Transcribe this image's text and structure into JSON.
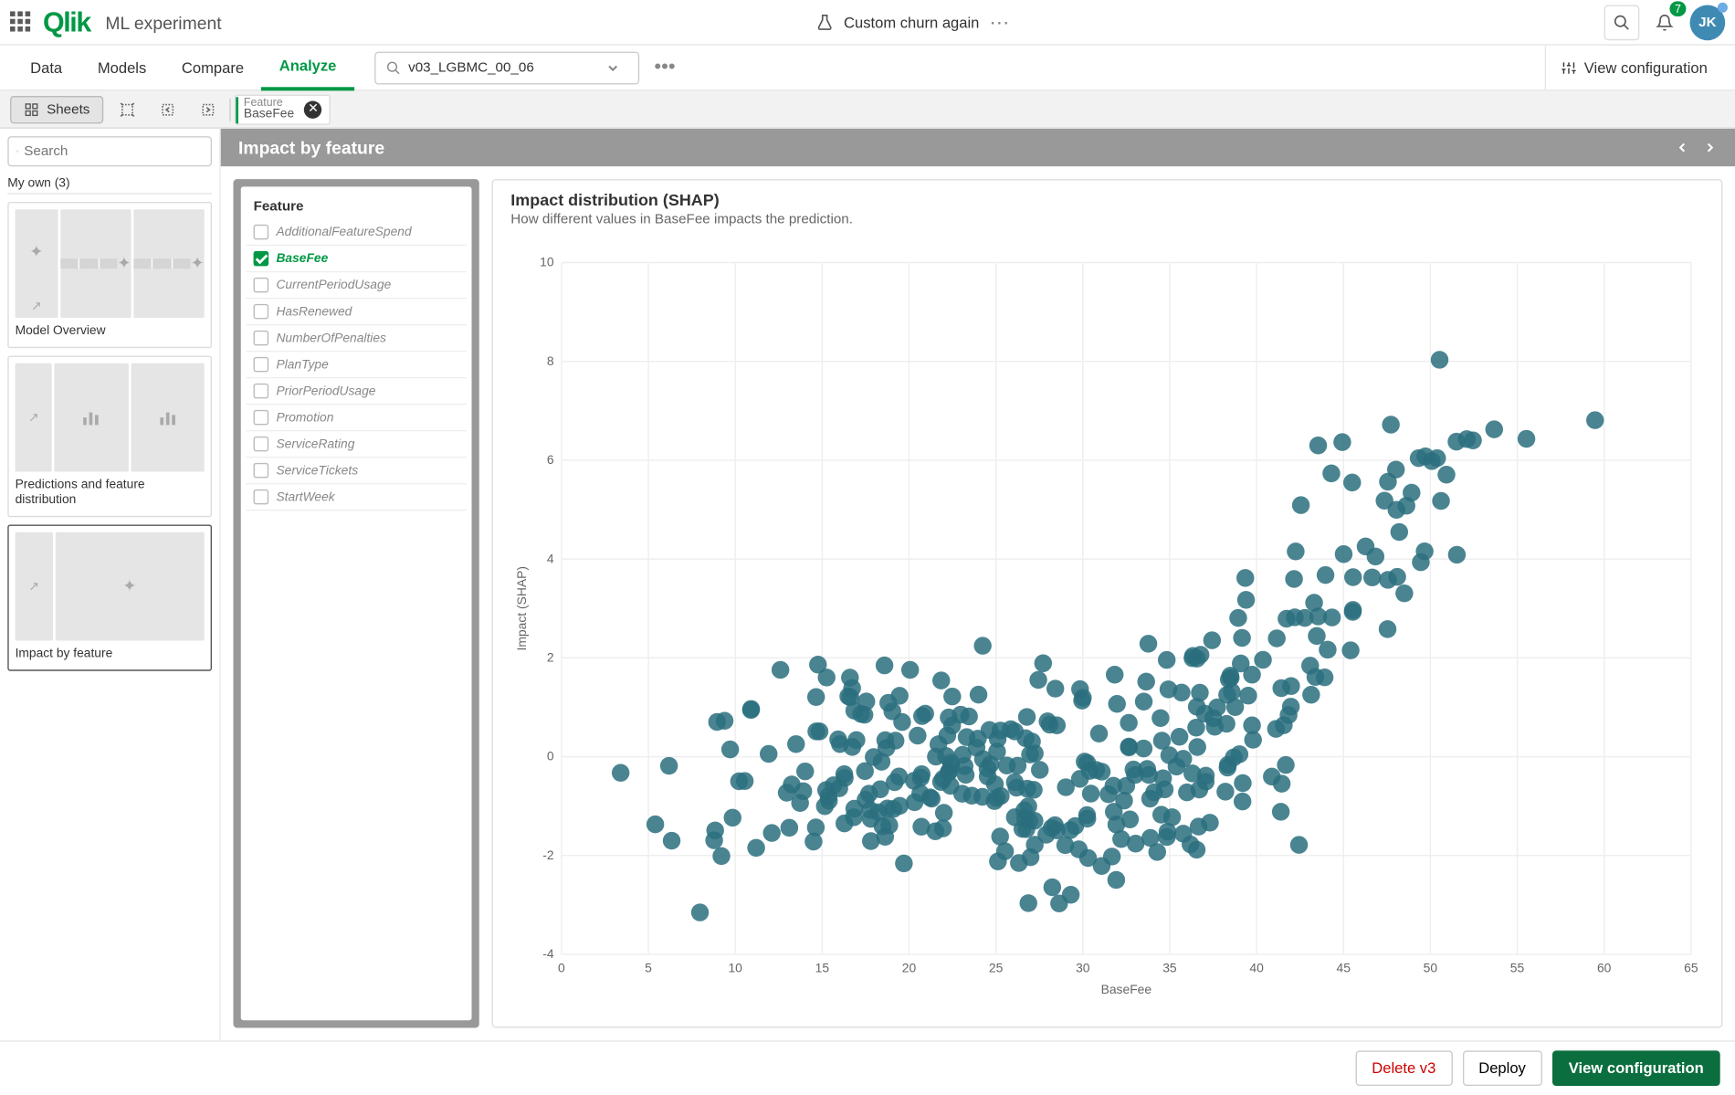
{
  "header": {
    "app_title": "ML experiment",
    "experiment_name": "Custom churn again",
    "search_aria": "Search",
    "notification_count": "7",
    "avatar_initials": "JK"
  },
  "subbar": {
    "tabs": [
      "Data",
      "Models",
      "Compare",
      "Analyze"
    ],
    "active_tab": 3,
    "model_selected": "v03_LGBMC_00_06",
    "view_config": "View configuration"
  },
  "thirdbar": {
    "sheets_label": "Sheets",
    "feature_tag_label": "Feature",
    "feature_tag_value": "BaseFee"
  },
  "sidebar": {
    "search_placeholder": "Search",
    "myown_label": "My own (3)",
    "sheets": [
      {
        "label": "Model Overview"
      },
      {
        "label": "Predictions and feature distribution"
      },
      {
        "label": "Impact by feature"
      }
    ],
    "selected_sheet": 2
  },
  "content": {
    "header": "Impact by feature"
  },
  "feature_panel": {
    "title": "Feature",
    "items": [
      {
        "name": "AdditionalFeatureSpend",
        "checked": false
      },
      {
        "name": "BaseFee",
        "checked": true
      },
      {
        "name": "CurrentPeriodUsage",
        "checked": false
      },
      {
        "name": "HasRenewed",
        "checked": false
      },
      {
        "name": "NumberOfPenalties",
        "checked": false
      },
      {
        "name": "PlanType",
        "checked": false
      },
      {
        "name": "PriorPeriodUsage",
        "checked": false
      },
      {
        "name": "Promotion",
        "checked": false
      },
      {
        "name": "ServiceRating",
        "checked": false
      },
      {
        "name": "ServiceTickets",
        "checked": false
      },
      {
        "name": "StartWeek",
        "checked": false
      }
    ]
  },
  "chart": {
    "title": "Impact distribution (SHAP)",
    "subtitle": "How different values in BaseFee impacts the prediction.",
    "xlabel": "BaseFee",
    "ylabel": "Impact (SHAP)"
  },
  "chart_data": {
    "type": "scatter",
    "xlabel": "BaseFee",
    "ylabel": "Impact (SHAP)",
    "xlim": [
      0,
      65
    ],
    "ylim": [
      -4,
      10
    ],
    "x_ticks": [
      0,
      5,
      10,
      15,
      20,
      25,
      30,
      35,
      40,
      45,
      50,
      55,
      60,
      65
    ],
    "y_ticks": [
      -4,
      -2,
      0,
      2,
      4,
      6,
      8,
      10
    ],
    "point_color": "#2a6f7e",
    "clusters": [
      {
        "cx": 3.5,
        "cy": -0.3,
        "n": 1,
        "sx": 0.1,
        "sy": 0.1
      },
      {
        "cx": 6.5,
        "cy": -0.8,
        "n": 3,
        "sx": 0.6,
        "sy": 0.5
      },
      {
        "cx": 8.5,
        "cy": -0.2,
        "n": 5,
        "sx": 0.8,
        "sy": 0.9
      },
      {
        "cx": 9.5,
        "cy": -1.4,
        "n": 4,
        "sx": 0.7,
        "sy": 0.5
      },
      {
        "cx": 11.0,
        "cy": 0.9,
        "n": 2,
        "sx": 0.3,
        "sy": 0.2
      },
      {
        "cx": 12.0,
        "cy": -0.3,
        "n": 8,
        "sx": 1.2,
        "sy": 1.0
      },
      {
        "cx": 14.5,
        "cy": 1.8,
        "n": 3,
        "sx": 0.6,
        "sy": 0.6
      },
      {
        "cx": 15.0,
        "cy": -0.1,
        "n": 18,
        "sx": 1.4,
        "sy": 0.9
      },
      {
        "cx": 17.5,
        "cy": 0.5,
        "n": 10,
        "sx": 1.5,
        "sy": 1.2
      },
      {
        "cx": 18.0,
        "cy": -0.4,
        "n": 22,
        "sx": 1.6,
        "sy": 0.8
      },
      {
        "cx": 20.5,
        "cy": -0.2,
        "n": 25,
        "sx": 1.8,
        "sy": 0.9
      },
      {
        "cx": 23.0,
        "cy": -0.3,
        "n": 30,
        "sx": 2.0,
        "sy": 1.0
      },
      {
        "cx": 24.0,
        "cy": 1.8,
        "n": 2,
        "sx": 0.3,
        "sy": 0.4
      },
      {
        "cx": 26.0,
        "cy": -0.4,
        "n": 28,
        "sx": 2.0,
        "sy": 1.0
      },
      {
        "cx": 29.0,
        "cy": -0.3,
        "n": 30,
        "sx": 2.0,
        "sy": 1.1
      },
      {
        "cx": 31.5,
        "cy": -0.6,
        "n": 28,
        "sx": 2.0,
        "sy": 1.0
      },
      {
        "cx": 34.0,
        "cy": -0.4,
        "n": 25,
        "sx": 2.0,
        "sy": 1.1
      },
      {
        "cx": 36.5,
        "cy": 0.1,
        "n": 22,
        "sx": 1.6,
        "sy": 1.2
      },
      {
        "cx": 38.5,
        "cy": 0.8,
        "n": 18,
        "sx": 1.4,
        "sy": 1.3
      },
      {
        "cx": 40.5,
        "cy": 1.5,
        "n": 16,
        "sx": 1.3,
        "sy": 1.4
      },
      {
        "cx": 42.5,
        "cy": 2.3,
        "n": 14,
        "sx": 1.2,
        "sy": 1.4
      },
      {
        "cx": 44.5,
        "cy": 3.2,
        "n": 12,
        "sx": 1.1,
        "sy": 1.4
      },
      {
        "cx": 46.5,
        "cy": 4.0,
        "n": 10,
        "sx": 1.0,
        "sy": 1.3
      },
      {
        "cx": 48.0,
        "cy": 4.6,
        "n": 8,
        "sx": 0.9,
        "sy": 1.0
      },
      {
        "cx": 50.0,
        "cy": 5.1,
        "n": 6,
        "sx": 0.9,
        "sy": 0.8
      },
      {
        "cx": 51.0,
        "cy": 6.4,
        "n": 4,
        "sx": 0.6,
        "sy": 0.5
      },
      {
        "cx": 50.5,
        "cy": 8.0,
        "n": 1,
        "sx": 0.1,
        "sy": 0.1
      },
      {
        "cx": 53.0,
        "cy": 6.5,
        "n": 2,
        "sx": 0.4,
        "sy": 0.2
      },
      {
        "cx": 55.5,
        "cy": 6.5,
        "n": 1,
        "sx": 0.1,
        "sy": 0.1
      },
      {
        "cx": 59.5,
        "cy": 6.8,
        "n": 1,
        "sx": 0.1,
        "sy": 0.1
      }
    ]
  },
  "bottom": {
    "delete": "Delete v3",
    "deploy": "Deploy",
    "view_config": "View configuration"
  }
}
